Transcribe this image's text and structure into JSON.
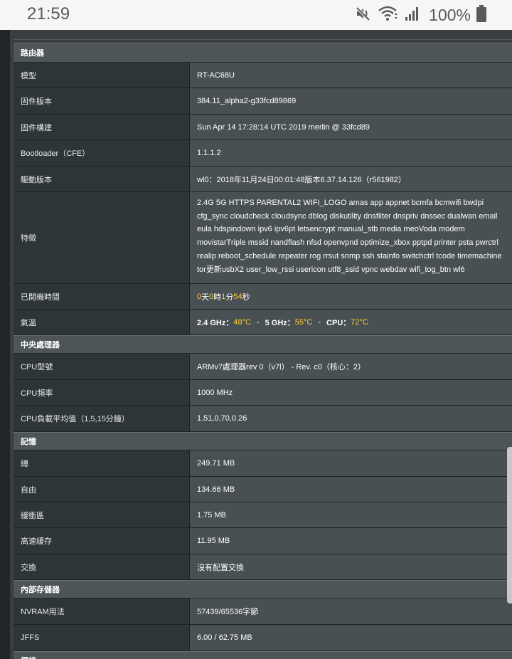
{
  "status_bar": {
    "time": "21:59",
    "battery": "100%",
    "icons": [
      "mute-icon",
      "wifi-icon",
      "signal-icon",
      "battery-icon"
    ]
  },
  "sections": {
    "router": {
      "title": "路由器",
      "model_label": "模型",
      "model_value": "RT-AC68U",
      "fw_label": "固件版本",
      "fw_value": "384.11_alpha2-g33fcd89869",
      "build_label": "固件構建",
      "build_value": "Sun Apr 14 17:28:14 UTC 2019 merlin @ 33fcd89",
      "boot_label": "Bootloader（CFE）",
      "boot_value": "1.1.1.2",
      "driver_label": "驅動版本",
      "driver_value": "wl0：2018年11月24日00:01:48版本6.37.14.126（r561982）",
      "features_label": "特徵",
      "features_lines": [
        "2.4G 5G HTTPS PARENTAL2 WIFI_LOGO amas app appnet bcmfa bcmwifi bwdpi",
        "cfg_sync cloudcheck cloudsync dblog diskutility dnsfilter dnspriv dnssec dualwan email",
        "eula hdspindown ipv6 ipv6pt letsencrypt manual_stb media meoVoda modem",
        "movistarTriple mssid nandflash nfsd openvpnd optimize_xbox pptpd printer psta pwrctrl",
        "realip reboot_schedule repeater rog rrsut snmp ssh stainfo switchctrl tcode timemachine",
        "tor更新usbX2 user_low_rssi usericon utf8_ssid vpnc webdav wifi_tog_btn wl6"
      ],
      "uptime_label": "已開機時間",
      "uptime": {
        "d": "0",
        "d_unit": "天",
        "h": "0",
        "h_unit": "時",
        "m": "1",
        "m_unit": "分",
        "s": "54",
        "s_unit": "秒"
      },
      "temp_label": "氣溫",
      "temp": {
        "g24_label": "2.4 GHz：",
        "g24": "48°C",
        "g5_label": "5 GHz：",
        "g5": "55°C",
        "cpu_label": "CPU：",
        "cpu": "72°C",
        "sep": "-"
      }
    },
    "cpu": {
      "title": "中央處理器",
      "model_label": "CPU型號",
      "model_value": "ARMv7處理器rev 0（v7l） - Rev. c0（核心：2）",
      "freq_label": "CPU頻率",
      "freq_value": "1000 MHz",
      "load_label": "CPU負載平均值（1,5,15分鐘）",
      "load_value": "1.51,0.70,0.26"
    },
    "memory": {
      "title": "記憶",
      "total_label": "總",
      "total_value": "249.71 MB",
      "free_label": "自由",
      "free_value": "134.66 MB",
      "buffer_label": "緩衝區",
      "buffer_value": "1.75 MB",
      "cache_label": "高速緩存",
      "cache_value": "11.95 MB",
      "swap_label": "交換",
      "swap_value": "沒有配置交換"
    },
    "storage": {
      "title": "內部存儲器",
      "nvram_label": "NVRAM用法",
      "nvram_value": "57439/65536字節",
      "jffs_label": "JFFS",
      "jffs_value": "6.00 / 62.75 MB"
    },
    "network": {
      "title": "網絡"
    }
  },
  "colors": {
    "highlight": "#ffcc33",
    "section_bg": "#4d5558",
    "label_bg": "#2e3537",
    "value_bg": "#485053"
  }
}
